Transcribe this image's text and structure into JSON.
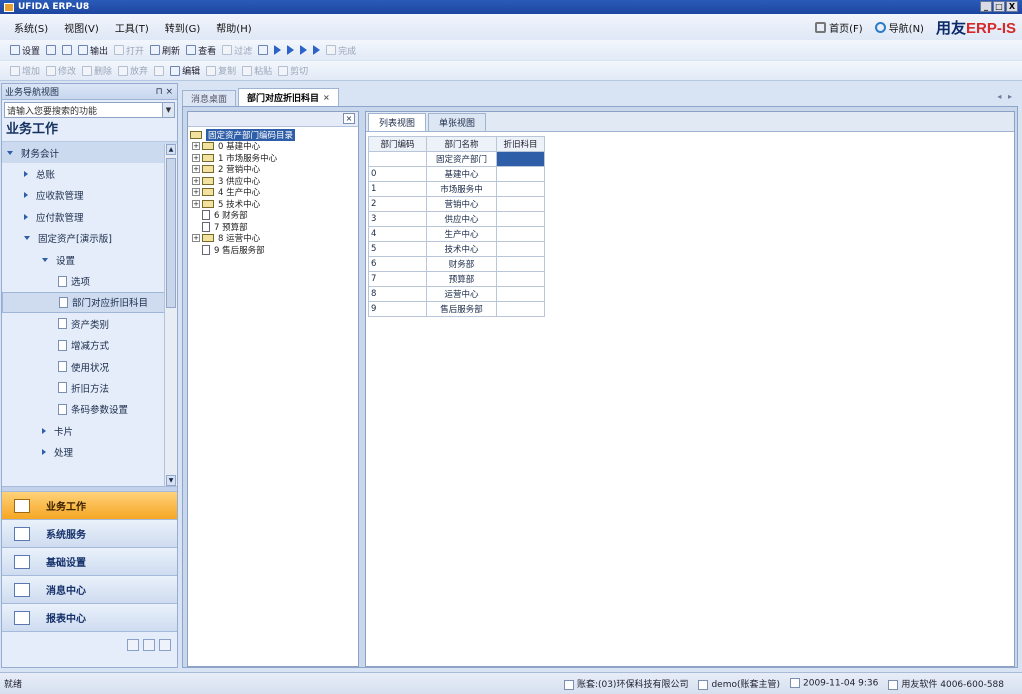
{
  "window": {
    "title": "UFIDA ERP-U8",
    "controls": [
      "_",
      "□",
      "X"
    ]
  },
  "menu": {
    "items": [
      "系统(S)",
      "视图(V)",
      "工具(T)",
      "转到(G)",
      "帮助(H)"
    ],
    "right": {
      "home": "首页(F)",
      "nav": "导航(N)",
      "brand_prefix": "用友",
      "brand_erp": "ERP",
      "brand_suffix": "-IS"
    }
  },
  "toolbar1": [
    "设置",
    "打印",
    "预览",
    "输出",
    "打开",
    "刷新",
    "查看",
    "过滤",
    "定位",
    "首张",
    "上张",
    "下张",
    "末张",
    "完成"
  ],
  "toolbar2": [
    "增加",
    "修改",
    "删除",
    "放弃",
    "保存",
    "编辑",
    "复制",
    "粘贴",
    "剪切"
  ],
  "nav": {
    "header": "业务导航视图",
    "pin": "⊓ ×",
    "search_placeholder": "请输入您要搜索的功能",
    "title": "业务工作",
    "tree": [
      {
        "label": "财务会计"
      },
      {
        "label": "总账"
      },
      {
        "label": "应收款管理"
      },
      {
        "label": "应付款管理"
      },
      {
        "label": "固定资产[演示版]"
      },
      {
        "label": "设置"
      },
      {
        "label": "选项"
      },
      {
        "label": "部门对应折旧科目"
      },
      {
        "label": "资产类别"
      },
      {
        "label": "增减方式"
      },
      {
        "label": "使用状况"
      },
      {
        "label": "折旧方法"
      },
      {
        "label": "条码参数设置"
      },
      {
        "label": "卡片"
      },
      {
        "label": "处理"
      }
    ],
    "sections": [
      "业务工作",
      "系统服务",
      "基础设置",
      "消息中心",
      "报表中心"
    ]
  },
  "tabs": [
    {
      "label": "消息桌面"
    },
    {
      "label": "部门对应折旧科目"
    }
  ],
  "tree_panel": {
    "close": "×",
    "root": "固定资产部门编码目录",
    "nodes": [
      {
        "exp": "+",
        "label": "0 基建中心",
        "type": "folder"
      },
      {
        "exp": "+",
        "label": "1 市场服务中心",
        "type": "folder"
      },
      {
        "exp": "+",
        "label": "2 营销中心",
        "type": "folder"
      },
      {
        "exp": "+",
        "label": "3 供应中心",
        "type": "folder"
      },
      {
        "exp": "+",
        "label": "4 生产中心",
        "type": "folder"
      },
      {
        "exp": "+",
        "label": "5 技术中心",
        "type": "folder"
      },
      {
        "exp": "",
        "label": "6 财务部",
        "type": "doc"
      },
      {
        "exp": "",
        "label": "7 预算部",
        "type": "doc"
      },
      {
        "exp": "+",
        "label": "8 运营中心",
        "type": "folder"
      },
      {
        "exp": "",
        "label": "9 售后服务部",
        "type": "doc"
      }
    ]
  },
  "grid": {
    "view_tabs": [
      "列表视图",
      "单张视图"
    ],
    "headers": [
      "部门编码",
      "部门名称",
      "折旧科目"
    ],
    "rows": [
      [
        "",
        "固定资产部门",
        ""
      ],
      [
        "0",
        "基建中心",
        ""
      ],
      [
        "1",
        "市场服务中",
        ""
      ],
      [
        "2",
        "营销中心",
        ""
      ],
      [
        "3",
        "供应中心",
        ""
      ],
      [
        "4",
        "生产中心",
        ""
      ],
      [
        "5",
        "技术中心",
        ""
      ],
      [
        "6",
        "财务部",
        ""
      ],
      [
        "7",
        "预算部",
        ""
      ],
      [
        "8",
        "运营中心",
        ""
      ],
      [
        "9",
        "售后服务部",
        ""
      ]
    ]
  },
  "statusbar": {
    "left": "就绪",
    "account": "账套:(03)环保科技有限公司",
    "user": "demo(账套主管)",
    "datetime": "2009-11-04 9:36",
    "phone": "用友软件 4006-600-588"
  },
  "colors": {
    "accent": "#2f5ea8",
    "active_section": "#f5a623",
    "brand_red": "#d42a2a"
  }
}
